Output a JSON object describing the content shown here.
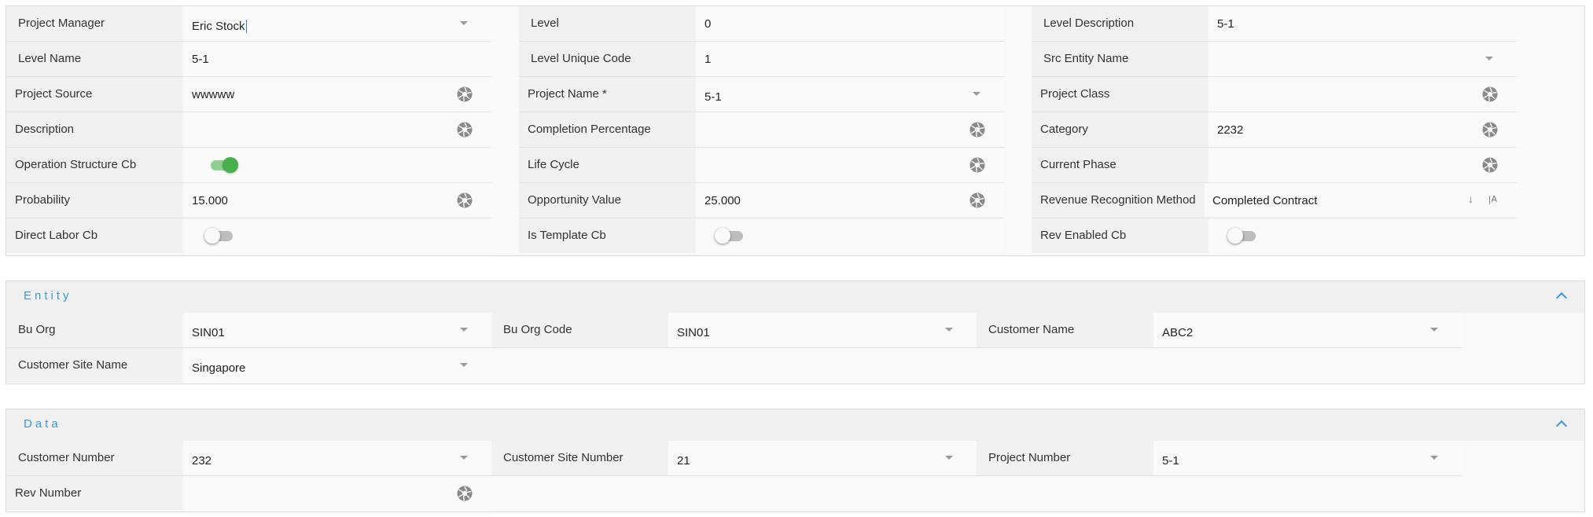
{
  "main_form": {
    "col1": [
      {
        "label": "Project Manager",
        "value": "Eric Stock"
      },
      {
        "label": "Level Name",
        "value": "5-1"
      },
      {
        "label": "Project Source",
        "value": "wwwww"
      },
      {
        "label": "Description",
        "value": ""
      },
      {
        "label": "Operation Structure Cb",
        "value": "on"
      },
      {
        "label": "Probability",
        "value": "15.000"
      },
      {
        "label": "Direct Labor Cb",
        "value": "off"
      }
    ],
    "col2": [
      {
        "label": "Level",
        "value": "0"
      },
      {
        "label": "Level Unique Code",
        "value": "1"
      },
      {
        "label": "Project Name *",
        "value": "5-1"
      },
      {
        "label": "Completion Percentage",
        "value": ""
      },
      {
        "label": "Life Cycle",
        "value": ""
      },
      {
        "label": "Opportunity Value",
        "value": "25.000"
      },
      {
        "label": "Is Template Cb",
        "value": "off"
      }
    ],
    "col3": [
      {
        "label": "Level Description",
        "value": "5-1"
      },
      {
        "label": "Src Entity Name",
        "value": ""
      },
      {
        "label": "Project Class",
        "value": ""
      },
      {
        "label": "Category",
        "value": "2232"
      },
      {
        "label": "Current Phase",
        "value": ""
      },
      {
        "label": "Revenue Recognition Method",
        "value": "Completed Contract"
      },
      {
        "label": "Rev Enabled Cb",
        "value": "off"
      }
    ]
  },
  "entity_section": {
    "title": "Entity",
    "fields": [
      {
        "label": "Bu Org",
        "value": "SIN01"
      },
      {
        "label": "Bu Org Code",
        "value": "SIN01"
      },
      {
        "label": "Customer Name",
        "value": "ABC2"
      },
      {
        "label": "Customer Site Name",
        "value": "Singapore"
      }
    ]
  },
  "data_section": {
    "title": "Data",
    "fields": [
      {
        "label": "Customer Number",
        "value": "232"
      },
      {
        "label": "Customer Site Number",
        "value": "21"
      },
      {
        "label": "Project Number",
        "value": "5-1"
      },
      {
        "label": "Rev Number",
        "value": ""
      }
    ]
  },
  "icons": {
    "camera": "camera-shutter-icon",
    "dropdown": "chevron-down-icon",
    "collapse": "chevron-up-icon",
    "sort": "sort-down-icon",
    "text_case": "text-case-icon"
  },
  "colors": {
    "accent": "#3a9ad9",
    "toggle_on": "#47b04b",
    "toggle_off": "#bdbdbd",
    "label_bg": "#f1f1f1"
  }
}
